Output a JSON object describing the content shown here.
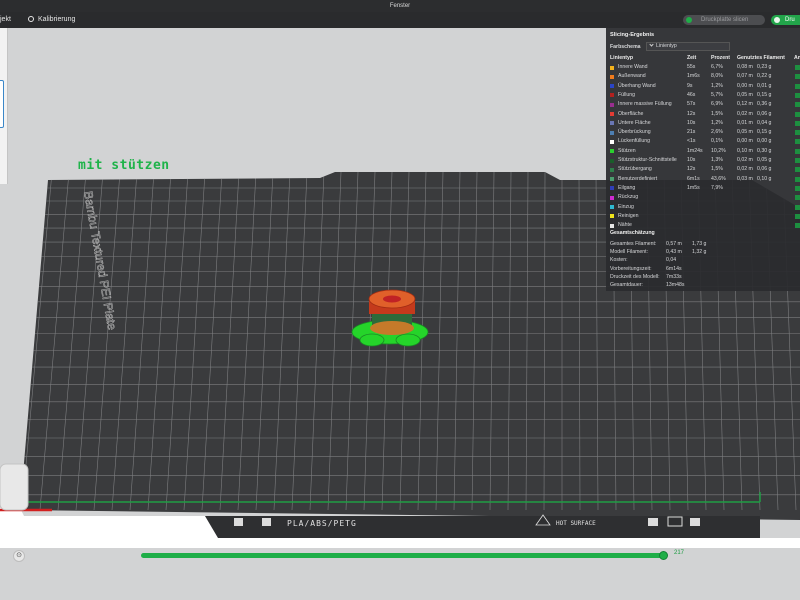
{
  "window": {
    "title": "Fenster"
  },
  "menu": {
    "project_label": "jekt",
    "calibration_label": "Kalibrierung"
  },
  "toolbar": {
    "slice_label": "Druckplatte slicen",
    "print_label": "Dru"
  },
  "bed": {
    "plate_text": "Bambu Textured PEI Plate",
    "label": "mit stützen",
    "filament_text": "PLA/ABS/PETG",
    "surface_text": "HOT SURFACE"
  },
  "slicing": {
    "title": "Slicing-Ergebnis",
    "scheme_label": "Farbschema",
    "scheme_value": "Linientyp",
    "headers": {
      "type": "Linientyp",
      "time": "Zeit",
      "percent": "Prozent",
      "filament": "Genutztes Filament",
      "extra": "An"
    },
    "rows": [
      {
        "name": "Innere Wand",
        "color": "#f3b21b",
        "time": "55s",
        "percent": "6,7%",
        "length": "0,08 m",
        "weight": "0,23 g"
      },
      {
        "name": "Außenwand",
        "color": "#f07b1d",
        "time": "1m6s",
        "percent": "8,0%",
        "length": "0,07 m",
        "weight": "0,22 g"
      },
      {
        "name": "Überhang Wand",
        "color": "#2a45c8",
        "time": "9s",
        "percent": "1,2%",
        "length": "0,00 m",
        "weight": "0,01 g"
      },
      {
        "name": "Füllung",
        "color": "#b3211f",
        "time": "46s",
        "percent": "5,7%",
        "length": "0,05 m",
        "weight": "0,15 g"
      },
      {
        "name": "Innere massive Füllung",
        "color": "#9a2e8f",
        "time": "57s",
        "percent": "6,9%",
        "length": "0,12 m",
        "weight": "0,36 g"
      },
      {
        "name": "Oberfläche",
        "color": "#e33c34",
        "time": "12s",
        "percent": "1,5%",
        "length": "0,02 m",
        "weight": "0,06 g"
      },
      {
        "name": "Untere Fläche",
        "color": "#6a77b5",
        "time": "10s",
        "percent": "1,2%",
        "length": "0,01 m",
        "weight": "0,04 g"
      },
      {
        "name": "Überbrückung",
        "color": "#4d7fb3",
        "time": "21s",
        "percent": "2,6%",
        "length": "0,05 m",
        "weight": "0,15 g"
      },
      {
        "name": "Lückenfüllung",
        "color": "#ffffff",
        "time": "<1s",
        "percent": "0,1%",
        "length": "0,00 m",
        "weight": "0,00 g"
      },
      {
        "name": "Stützen",
        "color": "#2bd12f",
        "time": "1m24s",
        "percent": "10,2%",
        "length": "0,10 m",
        "weight": "0,30 g"
      },
      {
        "name": "Stützstruktur-Schnittstelle",
        "color": "#1a5e2a",
        "time": "10s",
        "percent": "1,3%",
        "length": "0,02 m",
        "weight": "0,05 g"
      },
      {
        "name": "Stützübergang",
        "color": "#2f7f4a",
        "time": "12s",
        "percent": "1,5%",
        "length": "0,02 m",
        "weight": "0,06 g"
      },
      {
        "name": "Benutzerdefiniert",
        "color": "#4b9e6e",
        "time": "6m1s",
        "percent": "43,6%",
        "length": "0,03 m",
        "weight": "0,10 g"
      },
      {
        "name": "Eilgang",
        "color": "#2f3fb8",
        "time": "1m5s",
        "percent": "7,9%",
        "length": "",
        "weight": ""
      },
      {
        "name": "Rückzug",
        "color": "#cf2bd0",
        "time": "",
        "percent": "",
        "length": "",
        "weight": ""
      },
      {
        "name": "Einzug",
        "color": "#2fb8cf",
        "time": "",
        "percent": "",
        "length": "",
        "weight": ""
      },
      {
        "name": "Reinigen",
        "color": "#f0e41c",
        "time": "",
        "percent": "",
        "length": "",
        "weight": ""
      },
      {
        "name": "Nähte",
        "color": "#e6e6e6",
        "time": "",
        "percent": "",
        "length": "",
        "weight": ""
      }
    ],
    "estimate": {
      "title": "Gesamtschätzung",
      "items": [
        {
          "label": "Gesamtes Filament:",
          "value": "0,57 m",
          "value2": "1,73 g"
        },
        {
          "label": "Modell Filament:",
          "value": "0,43 m",
          "value2": "1,32 g"
        },
        {
          "label": "Kosten:",
          "value": "0,04",
          "value2": ""
        },
        {
          "label": "Vorbereitungszeit:",
          "value": "6m14s",
          "value2": ""
        },
        {
          "label": "Druckzeit des Modell:",
          "value": "7m33s",
          "value2": ""
        },
        {
          "label": "Gesamtdauer:",
          "value": "13m48s",
          "value2": ""
        }
      ]
    }
  },
  "layer_slider": {
    "value": "217",
    "fraction": 0.99
  },
  "colors": {
    "accent": "#1fae48",
    "bed": "#3a3b3d",
    "grid": "#7d7e80",
    "panel": "#2a2b2e"
  }
}
